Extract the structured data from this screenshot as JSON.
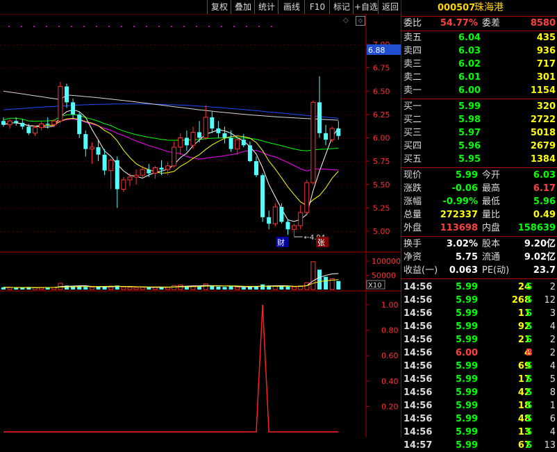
{
  "toolbar": {
    "buttons": [
      "复权",
      "叠加",
      "统计",
      "画线",
      "F10",
      "标记",
      "+自选",
      "返回"
    ]
  },
  "chart": {
    "price_axis": [
      "7.00",
      "6.75",
      "6.50",
      "6.25",
      "6.00",
      "5.75",
      "5.50",
      "5.25",
      "5.00"
    ],
    "current_price_tag": "6.88",
    "low_marker": "4.94",
    "marker_cai": "财",
    "marker_zhang": "张",
    "volume_axis": [
      "100000",
      "50000"
    ],
    "volume_unit": "X10",
    "indicator_axis": [
      "1.00",
      "0.80",
      "0.60",
      "0.40",
      "0.20"
    ],
    "colors": {
      "up": "#ff3333",
      "down": "#54fcfc",
      "ma5": "#ffffff",
      "ma10": "#ffff00",
      "ma20": "#ff00ff",
      "ma60": "#00ff00",
      "ma120": "#1e4cff",
      "ma250": "#d8d8d8"
    },
    "candles": [
      [
        6.18,
        6.22,
        6.12,
        6.14
      ],
      [
        6.14,
        6.2,
        6.1,
        6.18
      ],
      [
        6.18,
        6.22,
        6.13,
        6.16
      ],
      [
        6.16,
        6.2,
        6.09,
        6.12
      ],
      [
        6.12,
        6.15,
        6.03,
        6.05
      ],
      [
        6.05,
        6.13,
        6.02,
        6.11
      ],
      [
        6.11,
        6.18,
        6.08,
        6.15
      ],
      [
        6.15,
        6.22,
        6.1,
        6.14
      ],
      [
        6.14,
        6.2,
        6.11,
        6.18
      ],
      [
        6.18,
        6.6,
        6.16,
        6.55
      ],
      [
        6.55,
        6.58,
        6.32,
        6.38
      ],
      [
        6.38,
        6.42,
        6.2,
        6.25
      ],
      [
        6.25,
        6.28,
        6.0,
        6.04
      ],
      [
        6.04,
        6.08,
        5.8,
        5.88
      ],
      [
        5.88,
        5.95,
        5.72,
        5.9
      ],
      [
        5.9,
        5.98,
        5.75,
        5.82
      ],
      [
        5.82,
        5.88,
        5.6,
        5.65
      ],
      [
        5.65,
        5.78,
        5.45,
        5.76
      ],
      [
        5.76,
        5.8,
        5.25,
        5.45
      ],
      [
        5.45,
        5.58,
        5.42,
        5.55
      ],
      [
        5.55,
        5.62,
        5.48,
        5.58
      ],
      [
        5.58,
        5.66,
        5.5,
        5.6
      ],
      [
        5.6,
        5.7,
        5.56,
        5.66
      ],
      [
        5.66,
        5.72,
        5.58,
        5.62
      ],
      [
        5.62,
        5.7,
        5.56,
        5.68
      ],
      [
        5.68,
        5.76,
        5.6,
        5.66
      ],
      [
        5.66,
        5.74,
        5.6,
        5.7
      ],
      [
        5.7,
        5.96,
        5.68,
        5.9
      ],
      [
        5.9,
        6.05,
        5.82,
        6.0
      ],
      [
        6.0,
        6.08,
        5.86,
        5.92
      ],
      [
        5.92,
        6.12,
        5.88,
        6.06
      ],
      [
        6.06,
        6.18,
        5.95,
        6.0
      ],
      [
        6.0,
        6.35,
        5.98,
        6.22
      ],
      [
        6.22,
        6.28,
        6.05,
        6.1
      ],
      [
        6.1,
        6.18,
        6.0,
        6.05
      ],
      [
        6.05,
        6.12,
        5.94,
        6.0
      ],
      [
        6.0,
        6.08,
        5.85,
        5.88
      ],
      [
        5.88,
        6.0,
        5.82,
        5.98
      ],
      [
        5.98,
        6.04,
        5.9,
        5.92
      ],
      [
        5.92,
        5.96,
        5.74,
        5.75
      ],
      [
        5.75,
        5.8,
        5.58,
        5.6
      ],
      [
        5.6,
        5.62,
        5.1,
        5.15
      ],
      [
        5.15,
        5.22,
        5.02,
        5.08
      ],
      [
        5.08,
        5.3,
        5.05,
        5.26
      ],
      [
        5.26,
        5.3,
        5.08,
        5.1
      ],
      [
        5.1,
        5.12,
        4.96,
        5.02
      ],
      [
        5.02,
        5.08,
        4.94,
        5.06
      ],
      [
        5.06,
        5.28,
        5.02,
        5.2
      ],
      [
        5.2,
        5.55,
        5.18,
        5.52
      ],
      [
        5.52,
        6.4,
        5.5,
        6.38
      ],
      [
        6.38,
        6.66,
        6.0,
        6.05
      ],
      [
        6.05,
        6.14,
        5.92,
        5.98
      ],
      [
        5.98,
        6.12,
        5.95,
        6.1
      ],
      [
        6.1,
        6.18,
        5.98,
        6.02
      ]
    ],
    "volumes": [
      8,
      7,
      6,
      7,
      9,
      6,
      7,
      8,
      7,
      22,
      14,
      10,
      12,
      9,
      8,
      9,
      10,
      12,
      14,
      9,
      8,
      7,
      8,
      7,
      8,
      9,
      8,
      14,
      16,
      12,
      13,
      11,
      20,
      13,
      10,
      9,
      11,
      9,
      8,
      10,
      12,
      18,
      14,
      12,
      11,
      10,
      9,
      13,
      24,
      98,
      70,
      45,
      38,
      30
    ],
    "indicator_peak_index": 41
  },
  "quote": {
    "code": "000507",
    "name": "珠海港",
    "weibi_label": "委比",
    "weibi": "54.77%",
    "weicha_label": "委差",
    "weicha": "8580",
    "sell": [
      {
        "label": "卖五",
        "price": "6.04",
        "vol": "435"
      },
      {
        "label": "卖四",
        "price": "6.03",
        "vol": "936"
      },
      {
        "label": "卖三",
        "price": "6.02",
        "vol": "717"
      },
      {
        "label": "卖二",
        "price": "6.01",
        "vol": "301"
      },
      {
        "label": "卖一",
        "price": "6.00",
        "vol": "1154"
      }
    ],
    "buy": [
      {
        "label": "买一",
        "price": "5.99",
        "vol": "320"
      },
      {
        "label": "买二",
        "price": "5.98",
        "vol": "2722"
      },
      {
        "label": "买三",
        "price": "5.97",
        "vol": "5018"
      },
      {
        "label": "买四",
        "price": "5.96",
        "vol": "2679"
      },
      {
        "label": "买五",
        "price": "5.95",
        "vol": "1384"
      }
    ],
    "stats": [
      {
        "l1": "现价",
        "v1": "5.99",
        "c1": "green",
        "l2": "今开",
        "v2": "6.03",
        "c2": "green"
      },
      {
        "l1": "涨跌",
        "v1": "-0.06",
        "c1": "green",
        "l2": "最高",
        "v2": "6.17",
        "c2": "red"
      },
      {
        "l1": "涨幅",
        "v1": "-0.99%",
        "c1": "green",
        "l2": "最低",
        "v2": "5.96",
        "c2": "green"
      },
      {
        "l1": "总量",
        "v1": "272337",
        "c1": "yellow",
        "l2": "量比",
        "v2": "0.49",
        "c2": "yellow"
      },
      {
        "l1": "外盘",
        "v1": "113698",
        "c1": "red",
        "l2": "内盘",
        "v2": "158639",
        "c2": "green"
      }
    ],
    "fin": [
      {
        "l1": "换手",
        "v1": "3.02%",
        "l2": "股本",
        "v2": "9.20亿"
      },
      {
        "l1": "净资",
        "v1": "5.75",
        "l2": "流通",
        "v2": "9.02亿"
      },
      {
        "l1": "收益(一)",
        "v1": "0.063",
        "l2": "PE(动)",
        "v2": "23.7"
      }
    ],
    "ticks": [
      {
        "t": "14:56",
        "p": "5.99",
        "q": "24",
        "s": "S",
        "n": "2"
      },
      {
        "t": "14:56",
        "p": "5.99",
        "q": "268",
        "s": "S",
        "n": "12"
      },
      {
        "t": "14:56",
        "p": "5.99",
        "q": "11",
        "s": "S",
        "n": "3"
      },
      {
        "t": "14:56",
        "p": "5.99",
        "q": "92",
        "s": "S",
        "n": "4"
      },
      {
        "t": "14:56",
        "p": "5.99",
        "q": "21",
        "s": "S",
        "n": "2"
      },
      {
        "t": "14:56",
        "p": "6.00",
        "q": "4",
        "s": "B",
        "n": "2"
      },
      {
        "t": "14:56",
        "p": "5.99",
        "q": "69",
        "s": "S",
        "n": "4"
      },
      {
        "t": "14:56",
        "p": "5.99",
        "q": "17",
        "s": "S",
        "n": "5"
      },
      {
        "t": "14:56",
        "p": "5.99",
        "q": "42",
        "s": "S",
        "n": "8"
      },
      {
        "t": "14:56",
        "p": "5.99",
        "q": "18",
        "s": "S",
        "n": "1"
      },
      {
        "t": "14:56",
        "p": "5.99",
        "q": "48",
        "s": "S",
        "n": "6"
      },
      {
        "t": "14:56",
        "p": "5.99",
        "q": "13",
        "s": "S",
        "n": "4"
      },
      {
        "t": "14:57",
        "p": "5.99",
        "q": "67",
        "s": "S",
        "n": "13"
      }
    ]
  }
}
